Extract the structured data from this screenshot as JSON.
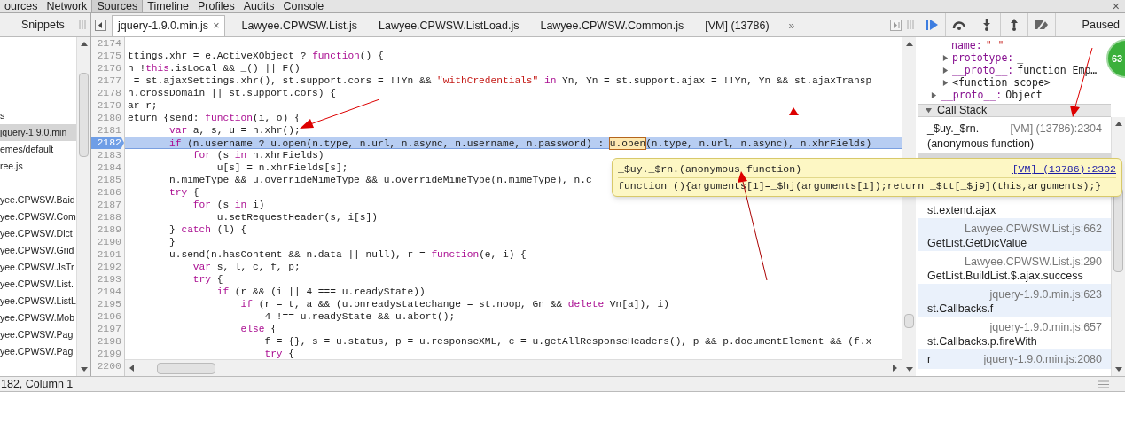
{
  "main_tabs": [
    {
      "label": "ources",
      "selected": false
    },
    {
      "label": "Network",
      "selected": false
    },
    {
      "label": "Sources",
      "selected": true
    },
    {
      "label": "Timeline",
      "selected": false
    },
    {
      "label": "Profiles",
      "selected": false
    },
    {
      "label": "Audits",
      "selected": false
    },
    {
      "label": "Console",
      "selected": false
    }
  ],
  "close_label": "×",
  "navigator": {
    "tabs": [
      {
        "label": "Snippets",
        "selected": false
      }
    ],
    "groups": [
      {
        "items": [
          {
            "label": "s",
            "selected": false
          },
          {
            "label": "jquery-1.9.0.min",
            "selected": true
          },
          {
            "label": "emes/default",
            "selected": false
          },
          {
            "label": "ree.js",
            "selected": false
          }
        ]
      },
      {
        "items": [
          {
            "label": "yee.CPWSW.Baid",
            "selected": false
          },
          {
            "label": "yee.CPWSW.Com",
            "selected": false
          },
          {
            "label": "yee.CPWSW.Dict",
            "selected": false
          },
          {
            "label": "yee.CPWSW.Grid",
            "selected": false
          },
          {
            "label": "yee.CPWSW.JsTr",
            "selected": false
          },
          {
            "label": "yee.CPWSW.List.",
            "selected": false
          },
          {
            "label": "yee.CPWSW.ListL",
            "selected": false
          },
          {
            "label": "yee.CPWSW.Mob",
            "selected": false
          },
          {
            "label": "yee.CPWSW.Pag",
            "selected": false
          },
          {
            "label": "yee.CPWSW.Pag",
            "selected": false
          }
        ]
      }
    ]
  },
  "editor_tabs": [
    {
      "label": "jquery-1.9.0.min.js",
      "selected": true,
      "close": "×"
    },
    {
      "label": "Lawyee.CPWSW.List.js",
      "selected": false
    },
    {
      "label": "Lawyee.CPWSW.ListLoad.js",
      "selected": false
    },
    {
      "label": "Lawyee.CPWSW.Common.js",
      "selected": false
    },
    {
      "label": "[VM] (13786)",
      "selected": false
    }
  ],
  "more_tabs": "»",
  "code_lines": [
    {
      "number": "2174",
      "current": false
    },
    {
      "number": "2175",
      "current": false,
      "segments": [
        {
          "text": "ttings.xhr = e.ActiveXObject ? ",
          "kind": "plain"
        },
        {
          "text": "function",
          "kind": "keyword"
        },
        {
          "text": "() {",
          "kind": "plain"
        }
      ]
    },
    {
      "number": "2176",
      "current": false,
      "segments": [
        {
          "text": "n !",
          "kind": "plain"
        },
        {
          "text": "this",
          "kind": "keyword"
        },
        {
          "text": ".isLocal && _() || F()",
          "kind": "plain"
        }
      ]
    },
    {
      "number": "2177",
      "current": false,
      "segments": [
        {
          "text": " = st.ajaxSettings.xhr(), st.support.cors = !!Yn && ",
          "kind": "plain"
        },
        {
          "text": "\"withCredentials\"",
          "kind": "string"
        },
        {
          "text": " in",
          "kind": "keyword"
        },
        {
          "text": " Yn, Yn = st.support.ajax = !!Yn, Yn && st.ajaxTransp",
          "kind": "plain"
        }
      ]
    },
    {
      "number": "2178",
      "current": false,
      "segments": [
        {
          "text": "n.crossDomain || st.support.cors) {",
          "kind": "plain"
        }
      ]
    },
    {
      "number": "2179",
      "current": false,
      "segments": [
        {
          "text": "ar r;",
          "kind": "plain"
        }
      ]
    },
    {
      "number": "2180",
      "current": false,
      "segments": [
        {
          "text": "eturn {send: ",
          "kind": "plain"
        },
        {
          "text": "function",
          "kind": "keyword"
        },
        {
          "text": "(i, o) {",
          "kind": "plain"
        }
      ]
    },
    {
      "number": "2181",
      "current": false,
      "segments": [
        {
          "text": "       var",
          "kind": "keyword"
        },
        {
          "text": " a, s, u = n.xhr();",
          "kind": "plain"
        }
      ]
    },
    {
      "number": "2182",
      "current": true,
      "segments": [
        {
          "text": "       if",
          "kind": "keyword"
        },
        {
          "text": " (n.username ? u.open(n.type, n.url, n.async, n.username, n.password) : ",
          "kind": "plain"
        },
        {
          "text": "u.open",
          "kind": "boxed"
        },
        {
          "text": "(n.type, n.url, n.async), n.xhrFields)",
          "kind": "plain"
        }
      ]
    },
    {
      "number": "2183",
      "current": false,
      "segments": [
        {
          "text": "           for",
          "kind": "keyword"
        },
        {
          "text": " (s ",
          "kind": "plain"
        },
        {
          "text": "in",
          "kind": "keyword"
        },
        {
          "text": " n.xhrFields)",
          "kind": "plain"
        }
      ]
    },
    {
      "number": "2184",
      "current": false,
      "segments": [
        {
          "text": "               u[s] = n.xhrFields[s];",
          "kind": "plain"
        }
      ]
    },
    {
      "number": "2185",
      "current": false,
      "segments": [
        {
          "text": "       n.mimeType && u.overrideMimeType && u.overrideMimeType(n.mimeType), n.c",
          "kind": "plain"
        }
      ]
    },
    {
      "number": "2186",
      "current": false,
      "segments": [
        {
          "text": "       try",
          "kind": "keyword"
        },
        {
          "text": " {",
          "kind": "plain"
        }
      ]
    },
    {
      "number": "2187",
      "current": false,
      "segments": [
        {
          "text": "           for",
          "kind": "keyword"
        },
        {
          "text": " (s ",
          "kind": "plain"
        },
        {
          "text": "in",
          "kind": "keyword"
        },
        {
          "text": " i)",
          "kind": "plain"
        }
      ]
    },
    {
      "number": "2188",
      "current": false,
      "segments": [
        {
          "text": "               u.setRequestHeader(s, i[s])",
          "kind": "plain"
        }
      ]
    },
    {
      "number": "2189",
      "current": false,
      "segments": [
        {
          "text": "       } ",
          "kind": "plain"
        },
        {
          "text": "catch",
          "kind": "keyword"
        },
        {
          "text": " (l) {",
          "kind": "plain"
        }
      ]
    },
    {
      "number": "2190",
      "current": false,
      "segments": [
        {
          "text": "       }",
          "kind": "plain"
        }
      ]
    },
    {
      "number": "2191",
      "current": false,
      "segments": [
        {
          "text": "       u.send(n.hasContent && n.data || null), r = ",
          "kind": "plain"
        },
        {
          "text": "function",
          "kind": "keyword"
        },
        {
          "text": "(e, i) {",
          "kind": "plain"
        }
      ]
    },
    {
      "number": "2192",
      "current": false,
      "segments": [
        {
          "text": "           var",
          "kind": "keyword"
        },
        {
          "text": " s, l, c, f, p;",
          "kind": "plain"
        }
      ]
    },
    {
      "number": "2193",
      "current": false,
      "segments": [
        {
          "text": "           try",
          "kind": "keyword"
        },
        {
          "text": " {",
          "kind": "plain"
        }
      ]
    },
    {
      "number": "2194",
      "current": false,
      "segments": [
        {
          "text": "               if",
          "kind": "keyword"
        },
        {
          "text": " (r && (i || 4 === u.readyState))",
          "kind": "plain"
        }
      ]
    },
    {
      "number": "2195",
      "current": false,
      "segments": [
        {
          "text": "                   if",
          "kind": "keyword"
        },
        {
          "text": " (r = t, a && (u.onreadystatechange = st.noop, Gn && ",
          "kind": "plain"
        },
        {
          "text": "delete",
          "kind": "keyword"
        },
        {
          "text": " Vn[a]), i)",
          "kind": "plain"
        }
      ]
    },
    {
      "number": "2196",
      "current": false,
      "segments": [
        {
          "text": "                       4 !== u.readyState && u.abort();",
          "kind": "plain"
        }
      ]
    },
    {
      "number": "2197",
      "current": false,
      "segments": [
        {
          "text": "                   else",
          "kind": "keyword"
        },
        {
          "text": " {",
          "kind": "plain"
        }
      ]
    },
    {
      "number": "2198",
      "current": false,
      "segments": [
        {
          "text": "                       f = {}, s = u.status, p = u.responseXML, c = u.getAllResponseHeaders(), p && p.documentElement && (f.x",
          "kind": "plain"
        }
      ]
    },
    {
      "number": "2199",
      "current": false,
      "segments": [
        {
          "text": "                       try",
          "kind": "keyword"
        },
        {
          "text": " {",
          "kind": "plain"
        }
      ]
    },
    {
      "number": "2200",
      "current": false
    }
  ],
  "tooltip": {
    "title": "_$uy._$rn.(anonymous function)",
    "link": "[VM]  (13786):2302",
    "body": "function (){arguments[1]=_$hj(arguments[1]);return _$tt[_$j9](this,arguments);}"
  },
  "debugger": {
    "status": "Paused"
  },
  "scope": [
    {
      "children": [
        {
          "key": "name:",
          "value": "\"_\"",
          "kind": "string"
        },
        {
          "key": "prototype:",
          "value": "_",
          "kind": "plain",
          "expanded": false
        },
        {
          "key": "__proto__:",
          "value": "function Emp…",
          "kind": "plain",
          "expanded": false
        },
        {
          "key": "<function scope>",
          "expanded": false
        }
      ]
    },
    {
      "key": "__proto__:",
      "value": "Object",
      "kind": "plain",
      "expanded": false
    }
  ],
  "call_stack": {
    "title": "Call Stack",
    "expanded": true,
    "frames": [
      {
        "kind": "inline",
        "function": "_$uy._$rn.",
        "location": "[VM] (13786):2304",
        "continued": "(anonymous function)"
      },
      {
        "kind": "hidden"
      },
      {
        "kind": "stacked",
        "function": "st.extend.ajax"
      },
      {
        "kind": "stacked",
        "function": "GetList.GetDicValue",
        "location": "Lawyee.CPWSW.List.js:662"
      },
      {
        "kind": "stacked",
        "function": "GetList.BuildList.$.ajax.success",
        "location": "Lawyee.CPWSW.List.js:290"
      },
      {
        "kind": "stacked",
        "function": "st.Callbacks.f",
        "location": "jquery-1.9.0.min.js:623"
      },
      {
        "kind": "stacked",
        "function": "st.Callbacks.p.fireWith",
        "location": "jquery-1.9.0.min.js:657"
      },
      {
        "kind": "inline",
        "function": "r",
        "location": "jquery-1.9.0.min.js:2080"
      }
    ]
  },
  "status_bar": {
    "position": "182, Column 1"
  },
  "badge": "63"
}
